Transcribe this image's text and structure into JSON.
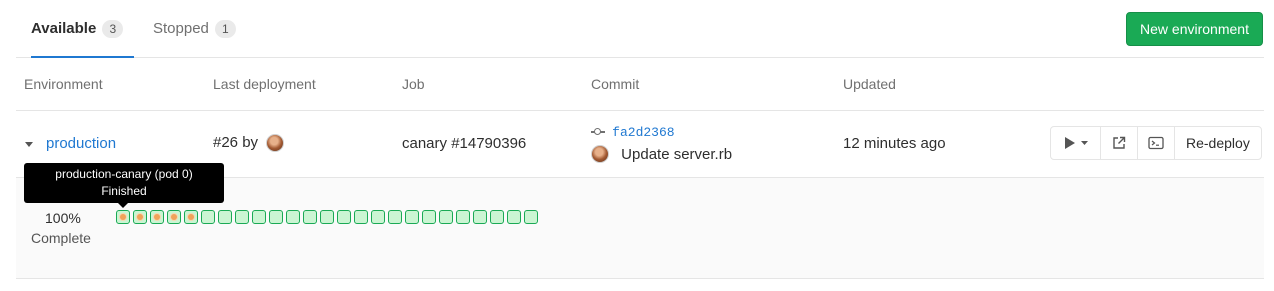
{
  "tabs": [
    {
      "label": "Available",
      "count": "3"
    },
    {
      "label": "Stopped",
      "count": "1"
    }
  ],
  "new_environment_label": "New environment",
  "columns": {
    "environment": "Environment",
    "last_deployment": "Last deployment",
    "job": "Job",
    "commit": "Commit",
    "updated": "Updated"
  },
  "environment": {
    "name": "production",
    "deployment": "#26 by",
    "job": "canary #14790396",
    "commit_sha": "fa2d2368",
    "commit_title": "Update server.rb",
    "updated": "12 minutes ago",
    "redeploy_label": "Re-deploy"
  },
  "deploy_board": {
    "percent": "100%",
    "status": "Complete",
    "instances_total": 25,
    "instances_in_progress": 5
  },
  "tooltip": {
    "title": "production-canary (pod 0)",
    "status": "Finished"
  },
  "icons": {
    "expand": "caret-down-icon",
    "commit": "commit-icon",
    "play": "play-icon",
    "external": "external-link-icon",
    "terminal": "terminal-icon"
  },
  "colors": {
    "accent": "#1f78d1",
    "success": "#1aaa55",
    "instance_fill": "#cbf5d3",
    "instance_dot": "#f0a35a"
  }
}
